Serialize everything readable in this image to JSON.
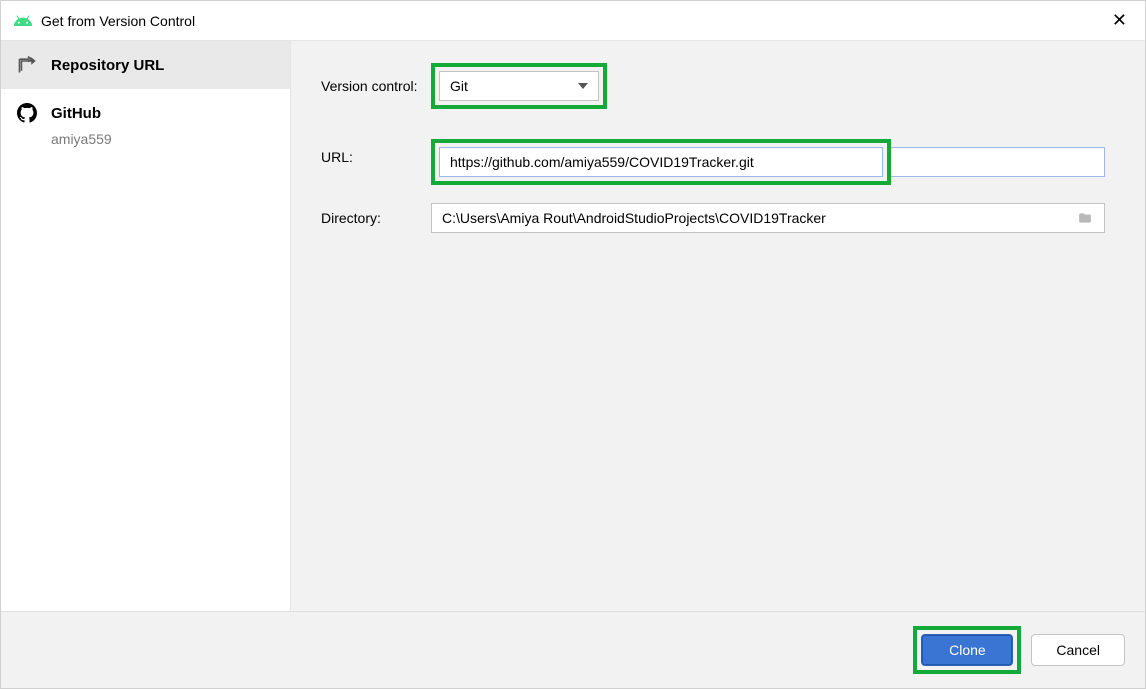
{
  "titlebar": {
    "title": "Get from Version Control"
  },
  "sidebar": {
    "items": [
      {
        "label": "Repository URL"
      },
      {
        "label": "GitHub",
        "sub": "amiya559"
      }
    ]
  },
  "form": {
    "version_control_label": "Version control:",
    "version_control_value": "Git",
    "url_label": "URL:",
    "url_value": "https://github.com/amiya559/COVID19Tracker.git",
    "directory_label": "Directory:",
    "directory_value": "C:\\Users\\Amiya Rout\\AndroidStudioProjects\\COVID19Tracker"
  },
  "footer": {
    "clone_label": "Clone",
    "cancel_label": "Cancel"
  },
  "colors": {
    "highlight": "#14aa37",
    "primary": "#3a75d3"
  }
}
